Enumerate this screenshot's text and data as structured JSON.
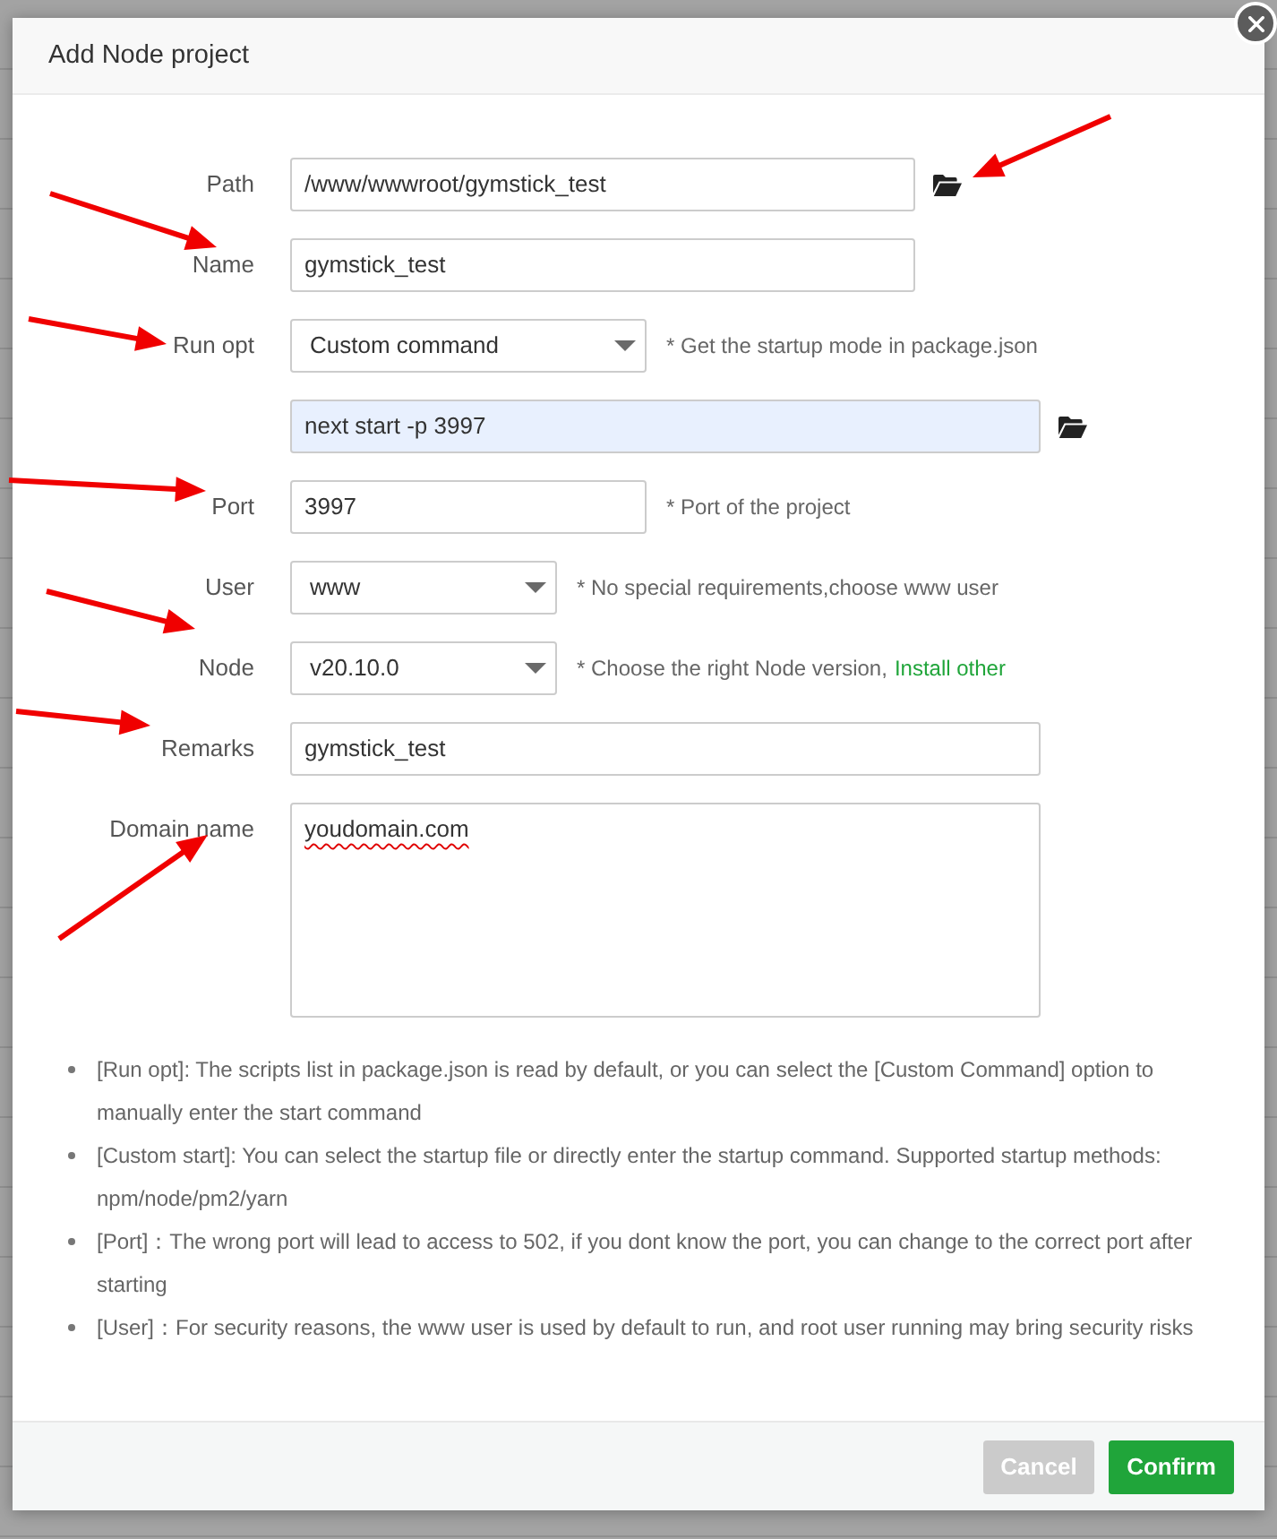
{
  "dialog": {
    "title": "Add Node project"
  },
  "form": {
    "rows": [
      {
        "label": "Path",
        "control": {
          "kind": "input",
          "value": "/www/wwwroot/gymstick_test"
        },
        "folder_button": true,
        "folder_arrow": true
      },
      {
        "label": "Name",
        "control": {
          "kind": "input",
          "value": "gymstick_test"
        },
        "arrow": true
      },
      {
        "label": "Run opt",
        "control": {
          "kind": "select",
          "value": "Custom command"
        },
        "hint": "* Get the startup mode in package.json",
        "arrow": true
      },
      {
        "control": {
          "kind": "input",
          "value": "next start -p 3997",
          "autofilled": true
        },
        "folder_button": true
      },
      {
        "label": "Port",
        "control": {
          "kind": "input",
          "value": "3997"
        },
        "hint": "* Port of the project",
        "arrow": true
      },
      {
        "label": "User",
        "control": {
          "kind": "select",
          "value": "www"
        },
        "hint": "* No special requirements,choose www user"
      },
      {
        "label": "Node",
        "control": {
          "kind": "select",
          "value": "v20.10.0"
        },
        "hint": "* Choose the right Node version,",
        "hint_link": "Install other",
        "arrow": true
      },
      {
        "label": "Remarks",
        "control": {
          "kind": "input",
          "value": "gymstick_test"
        },
        "arrow": true
      },
      {
        "label": "Domain name",
        "control": {
          "kind": "textarea",
          "value": "youdomain.com",
          "spelling_error": true
        },
        "arrow": true
      }
    ]
  },
  "notes": [
    "[Run opt]: The scripts list in package.json is read by default, or you can select the [Custom Command] option to manually enter the start command",
    "[Custom start]: You can select the startup file or directly enter the startup command. Supported startup methods: npm/node/pm2/yarn",
    "[Port]：The wrong port will lead to access to 502, if you dont know the port, you can change to the correct port after starting",
    "[User]：For security reasons, the www user is used by default to run, and root user running may bring security risks"
  ],
  "footer": {
    "buttons": [
      {
        "label": "Cancel",
        "kind": "cancel"
      },
      {
        "label": "Confirm",
        "kind": "confirm"
      }
    ]
  }
}
